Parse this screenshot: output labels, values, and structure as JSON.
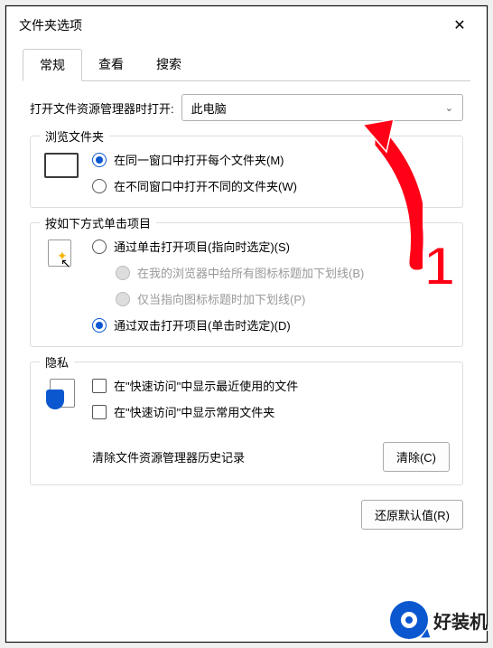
{
  "window": {
    "title": "文件夹选项"
  },
  "tabs": {
    "general": "常规",
    "view": "查看",
    "search": "搜索"
  },
  "open_explorer": {
    "label": "打开文件资源管理器时打开:",
    "selected": "此电脑"
  },
  "browse_group": {
    "title": "浏览文件夹",
    "same_window": "在同一窗口中打开每个文件夹(M)",
    "diff_window": "在不同窗口中打开不同的文件夹(W)"
  },
  "click_group": {
    "title": "按如下方式单击项目",
    "single_click": "通过单击打开项目(指向时选定)(S)",
    "underline_all": "在我的浏览器中给所有图标标题加下划线(B)",
    "underline_point": "仅当指向图标标题时加下划线(P)",
    "double_click": "通过双击打开项目(单击时选定)(D)"
  },
  "privacy_group": {
    "title": "隐私",
    "recent_files": "在\"快速访问\"中显示最近使用的文件",
    "frequent_folders": "在\"快速访问\"中显示常用文件夹",
    "clear_label": "清除文件资源管理器历史记录",
    "clear_btn": "清除(C)"
  },
  "footer": {
    "restore": "还原默认值(R)"
  },
  "annotation": {
    "number": "1"
  },
  "watermark": {
    "text": "好装机"
  }
}
